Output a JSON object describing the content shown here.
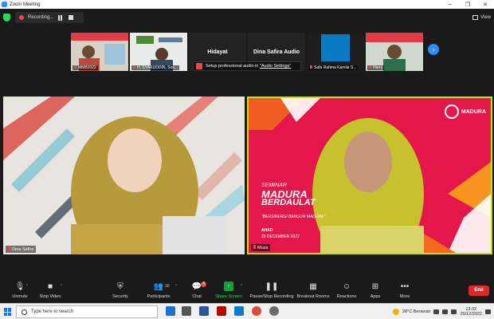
{
  "window": {
    "title": "Zoom Meeting",
    "controls": [
      "–",
      "❐",
      "✕"
    ]
  },
  "topbar": {
    "recording_label": "Recording...",
    "view_label": "View"
  },
  "thumbnails": [
    {
      "name": "MMB2022",
      "muted": true
    },
    {
      "name": "H. SYARUDDIN, Sos...",
      "muted": true
    },
    {
      "name": "Hidayat",
      "muted": false
    },
    {
      "name": "Dina Safira Audio",
      "muted": false
    },
    {
      "name": "Safa Rahma Kamila S...",
      "muted": true
    },
    {
      "name": "Harry",
      "muted": true
    }
  ],
  "tooltip": {
    "text_before": "Setup professional audio in ",
    "link": "\"Audio Settings\""
  },
  "tiles": {
    "left": {
      "name": "Dina Safira"
    },
    "right": {
      "name": "Muza",
      "banner": {
        "line1": "SEMINAR",
        "line2": "MADURA",
        "line3": "BERDAULAT",
        "tagline": "\"BERSINERGI BANGUN MADURA\"",
        "day": "AHAD",
        "date": "25 DECEMBER 2022",
        "logo_text": "MADURA"
      }
    }
  },
  "toolbar": {
    "unmute": "Unmute",
    "stop_video": "Stop Video",
    "security": "Security",
    "participants": "Participants",
    "participants_count": "10",
    "chat": "Chat",
    "chat_badge": "4",
    "share_screen": "Share Screen",
    "pause_recording": "Pause/Stop Recording",
    "breakout_rooms": "Breakout Rooms",
    "reactions": "Reactions",
    "apps": "Apps",
    "more": "More",
    "end": "End"
  },
  "taskbar": {
    "search_placeholder": "Type here to search",
    "weather": "28°C  Berawan",
    "time": "13:32",
    "date": "25/12/2022"
  },
  "colors": {
    "accent_blue": "#2d8cff",
    "active_speaker_border": "#c6e400",
    "banner_red": "#e3174a",
    "end_red": "#e02828",
    "share_green": "#0e9f3b"
  }
}
